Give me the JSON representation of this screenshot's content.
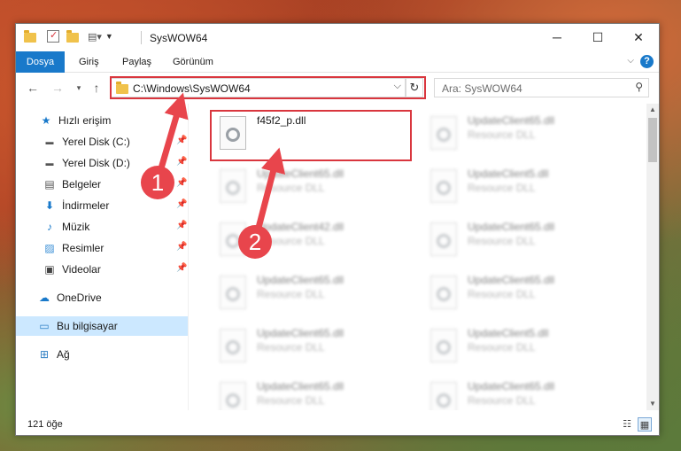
{
  "window": {
    "title": "SysWOW64",
    "controls": {
      "minimize": "─",
      "maximize": "☐",
      "close": "✕"
    }
  },
  "ribbon": {
    "tabs": [
      "Dosya",
      "Giriş",
      "Paylaş",
      "Görünüm"
    ],
    "help": "?"
  },
  "address": {
    "path": "C:\\Windows\\SysWOW64",
    "search_placeholder": "Ara: SysWOW64"
  },
  "sidebar": {
    "quick_access": "Hızlı erişim",
    "items": [
      {
        "label": "Yerel Disk (C:)",
        "icon": "drive-icon"
      },
      {
        "label": "Yerel Disk (D:)",
        "icon": "drive-icon"
      },
      {
        "label": "Belgeler",
        "icon": "documents-icon"
      },
      {
        "label": "İndirmeler",
        "icon": "downloads-icon"
      },
      {
        "label": "Müzik",
        "icon": "music-icon"
      },
      {
        "label": "Resimler",
        "icon": "pictures-icon"
      },
      {
        "label": "Videolar",
        "icon": "videos-icon"
      }
    ],
    "onedrive": "OneDrive",
    "this_pc": "Bu bilgisayar",
    "network": "Ağ"
  },
  "files": [
    {
      "name": "f45f2_p.dll",
      "type": ""
    },
    {
      "name": "UpdateClient65.dll",
      "type": "Resource DLL"
    },
    {
      "name": "UpdateClient65.dll",
      "type": "Resource DLL"
    },
    {
      "name": "UpdateClient5.dll",
      "type": "Resource DLL"
    },
    {
      "name": "UpdateClient42.dll",
      "type": "Resource DLL"
    },
    {
      "name": "UpdateClient65.dll",
      "type": "Resource DLL"
    },
    {
      "name": "UpdateClient65.dll",
      "type": "Resource DLL"
    },
    {
      "name": "UpdateClient65.dll",
      "type": "Resource DLL"
    },
    {
      "name": "UpdateClient65.dll",
      "type": "Resource DLL"
    },
    {
      "name": "UpdateClient5.dll",
      "type": "Resource DLL"
    },
    {
      "name": "UpdateClient65.dll",
      "type": "Resource DLL"
    },
    {
      "name": "UpdateClient65.dll",
      "type": "Resource DLL"
    }
  ],
  "status": {
    "count": "121 öğe"
  },
  "annotations": {
    "badge1": "1",
    "badge2": "2"
  },
  "colors": {
    "accent": "#1979ca",
    "highlight": "#d9363e",
    "selected": "#cce8ff"
  }
}
